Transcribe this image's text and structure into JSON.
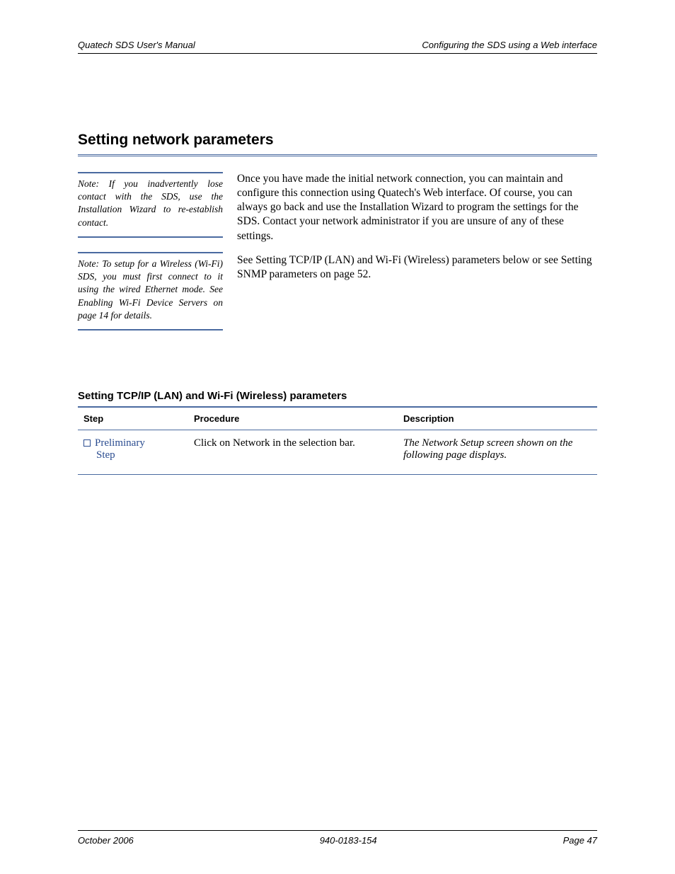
{
  "header": {
    "left": "Quatech SDS User's Manual",
    "right": "Configuring the SDS using a Web interface"
  },
  "section": {
    "heading": "Setting network parameters",
    "note1": "Note: If you inadvertently lose contact with the SDS, use the Installation Wizard to re-establish contact.",
    "note2": "Note: To setup for a Wireless (Wi-Fi) SDS, you must first connect to it using the wired Ethernet mode. See Enabling Wi-Fi Device Servers on page 14 for details.",
    "para1": "Once you have made the initial network connection, you can maintain and configure this connection using Quatech's Web interface. Of course, you can always go back and use the Installation Wizard to program the settings for the SDS. Contact your network administrator if you are unsure of any of these settings.",
    "para2": "See Setting TCP/IP (LAN) and Wi-Fi (Wireless) parameters below or see Setting SNMP parameters on page 52."
  },
  "sub": {
    "heading": "Setting TCP/IP (LAN) and Wi-Fi (Wireless) parameters",
    "columns": {
      "step": "Step",
      "procedure": "Procedure",
      "description": "Description"
    },
    "rows": [
      {
        "step_label": "Preliminary",
        "step_sub": "Step",
        "procedure": "Click on Network in the selection bar.",
        "description": "The Network Setup screen shown on the following page displays."
      }
    ]
  },
  "footer": {
    "left": "October 2006",
    "center": "940-0183-154",
    "right": "Page 47"
  }
}
